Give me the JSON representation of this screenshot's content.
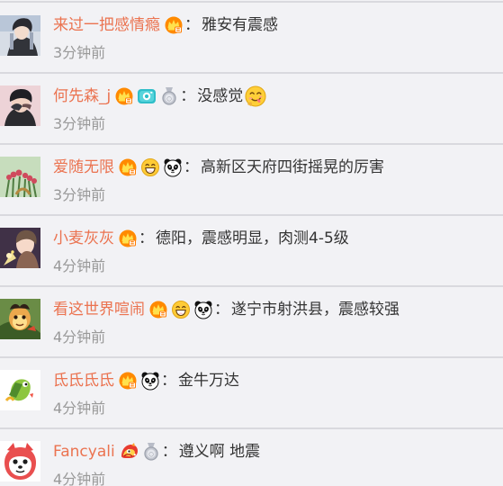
{
  "comments": [
    {
      "username": "来过一把感情瘾",
      "colon": "：",
      "content": "雅安有震感",
      "time": "3分钟前"
    },
    {
      "username": "何先森_j",
      "colon": "：",
      "content": "没感觉",
      "time": "3分钟前"
    },
    {
      "username": "爱随无限",
      "colon": "：",
      "content": "高新区天府四街摇晃的厉害",
      "time": "3分钟前"
    },
    {
      "username": "小麦灰灰",
      "colon": "：",
      "content": "德阳，震感明显，肉测4-5级",
      "time": "4分钟前"
    },
    {
      "username": "看这世界喧闹",
      "colon": "：",
      "content": "遂宁市射洪县，震感较强",
      "time": "4分钟前"
    },
    {
      "username": "氐氐氐氐",
      "colon": "：",
      "content": "金牛万达",
      "time": "4分钟前"
    },
    {
      "username": "Fancyali",
      "colon": "：",
      "content": "遵义啊  地震",
      "time": "4分钟前"
    }
  ],
  "theme": {
    "username_color": "#eb7350",
    "text_color": "#333333",
    "time_color": "#999999",
    "background": "#f2f2f5",
    "divider": "#d9d9de"
  }
}
